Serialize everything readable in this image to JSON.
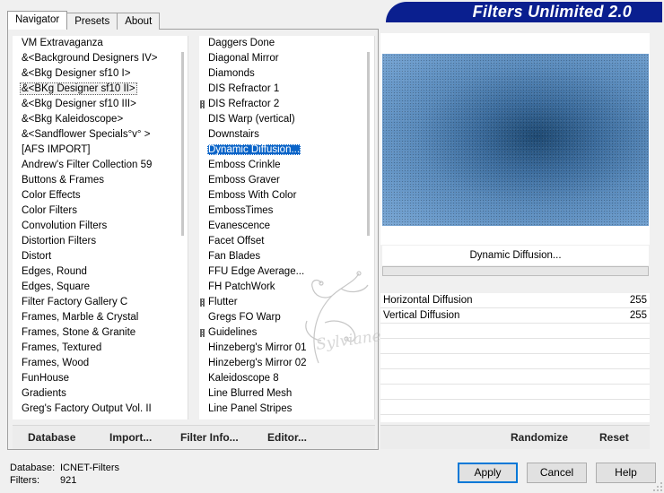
{
  "banner": {
    "title": "Filters Unlimited 2.0"
  },
  "tabs": [
    "Navigator",
    "Presets",
    "About"
  ],
  "categories": [
    "VM Extravaganza",
    "&<Background Designers IV>",
    "&<Bkg Designer sf10 I>",
    "&<BKg Designer sf10 II>",
    "&<Bkg Designer sf10 III>",
    "&<Bkg Kaleidoscope>",
    "&<Sandflower Specials°v° >",
    "[AFS IMPORT]",
    "Andrew's Filter Collection 59",
    "Buttons & Frames",
    "Color Effects",
    "Color Filters",
    "Convolution Filters",
    "Distortion Filters",
    "Distort",
    "Edges, Round",
    "Edges, Square",
    "Filter Factory Gallery C",
    "Frames, Marble & Crystal",
    "Frames, Stone & Granite",
    "Frames, Textured",
    "Frames, Wood",
    "FunHouse",
    "Gradients",
    "Greg's Factory Output Vol. II"
  ],
  "filters": [
    "Daggers Done",
    "Diagonal Mirror",
    "Diamonds",
    "DIS Refractor 1",
    "DIS Refractor 2",
    "DIS Warp (vertical)",
    "Downstairs",
    "Dynamic Diffusion...",
    "Emboss Crinkle",
    "Emboss Graver",
    "Emboss With Color",
    "EmbossTimes",
    "Evanescence",
    "Facet Offset",
    "Fan Blades",
    "FFU Edge Average...",
    "FH PatchWork",
    "Flutter",
    "Gregs FO Warp",
    "Guidelines",
    "Hinzeberg's Mirror 01",
    "Hinzeberg's Mirror 02",
    "Kaleidoscope 8",
    "Line Blurred Mesh",
    "Line Panel Stripes"
  ],
  "bottom_links": {
    "database": "Database",
    "import": "Import...",
    "filter_info": "Filter Info...",
    "editor": "Editor..."
  },
  "preview": {
    "filter_name": "Dynamic Diffusion..."
  },
  "params": [
    {
      "label": "Horizontal Diffusion",
      "value": "255"
    },
    {
      "label": "Vertical Diffusion",
      "value": "255"
    }
  ],
  "right_links": {
    "randomize": "Randomize",
    "reset": "Reset"
  },
  "status": {
    "database_label": "Database:",
    "database_value": "ICNET-Filters",
    "filters_label": "Filters:",
    "filters_value": "921"
  },
  "buttons": {
    "apply": "Apply",
    "cancel": "Cancel",
    "help": "Help"
  },
  "watermark": {
    "text": "Sylviane"
  },
  "colors": {
    "banner": "#0a1f8f",
    "selection": "#0a64c8",
    "apply_border": "#0078d7"
  }
}
